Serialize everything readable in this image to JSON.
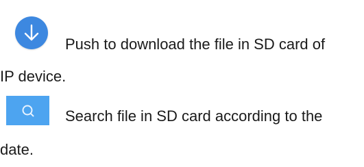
{
  "items": [
    {
      "icon": "download-icon",
      "icon_color": "#3d88e0",
      "text_line1": "Push to download the file in SD card of",
      "text_line2": "IP device."
    },
    {
      "icon": "search-icon",
      "icon_color": "#4da4f0",
      "text_line1": "Search file in SD card according to the",
      "text_line2": "date."
    }
  ]
}
